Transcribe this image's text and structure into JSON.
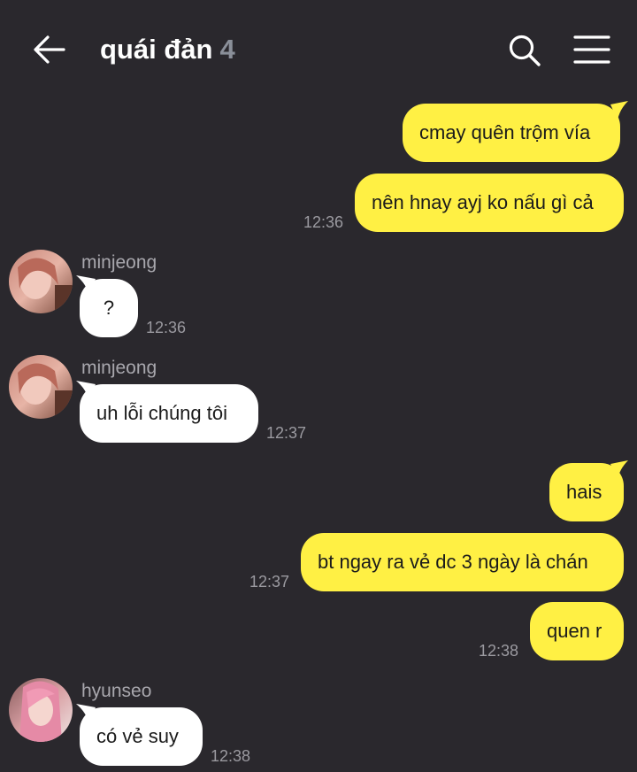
{
  "header": {
    "title": "quái đản",
    "member_count": "4"
  },
  "messages": [
    {
      "text": "cmay quên trộm vía"
    },
    {
      "text": "nên hnay ayj ko nấu gì cả",
      "time": "12:36"
    },
    {
      "sender": "minjeong",
      "text": "?",
      "time": "12:36"
    },
    {
      "sender": "minjeong",
      "text": "uh lỗi chúng tôi",
      "time": "12:37"
    },
    {
      "text": "hais"
    },
    {
      "text": "bt ngay ra vẻ dc 3 ngày là chán",
      "time": "12:37"
    },
    {
      "text": "quen r",
      "time": "12:38"
    },
    {
      "sender": "hyunseo",
      "text": "có vẻ suy",
      "time": "12:38"
    }
  ],
  "colors": {
    "background": "#2a282d",
    "my_bubble": "#fff044",
    "their_bubble": "#ffffff",
    "count": "#8a8f99"
  }
}
